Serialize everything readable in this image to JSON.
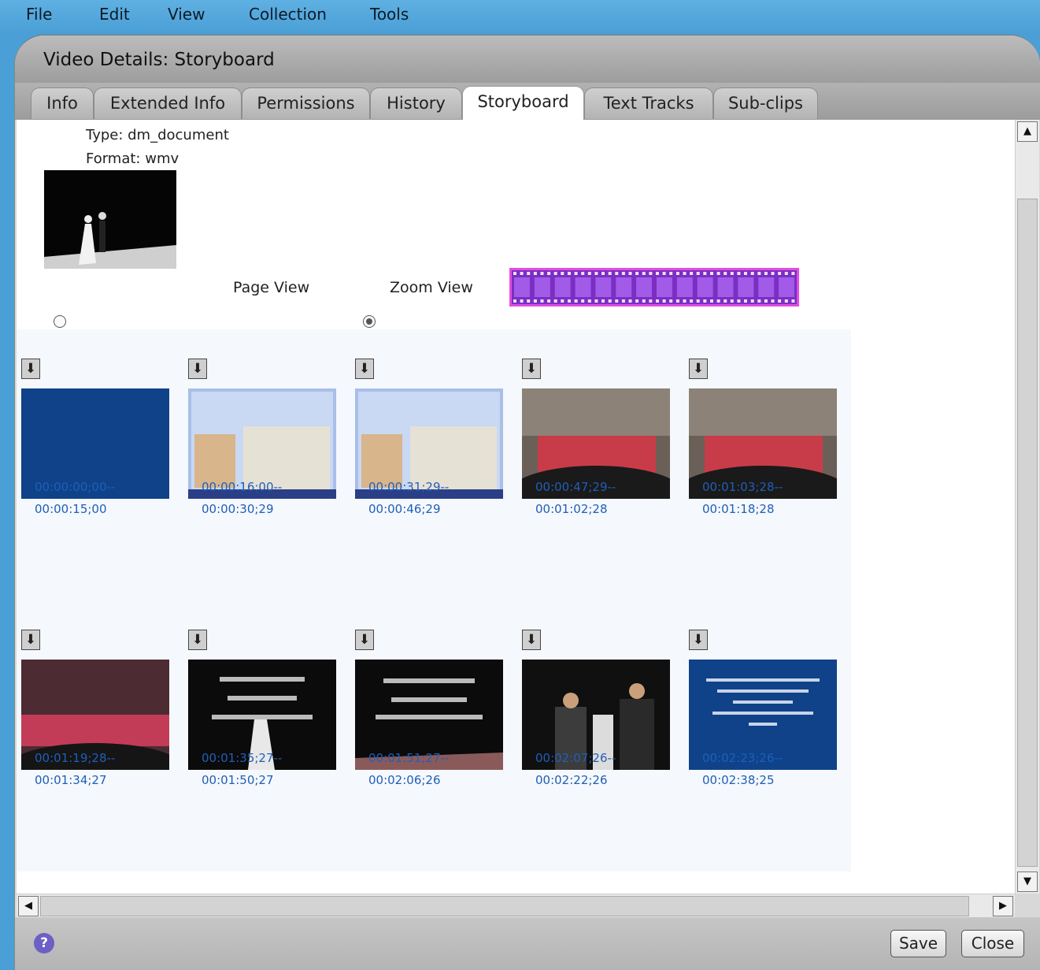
{
  "menu": [
    "File",
    "Edit",
    "View",
    "Collection",
    "Tools"
  ],
  "window": {
    "title": "Video Details: Storyboard"
  },
  "tabs": [
    {
      "label": "Info"
    },
    {
      "label": "Extended Info"
    },
    {
      "label": "Permissions"
    },
    {
      "label": "History"
    },
    {
      "label": "Storyboard",
      "active": true
    },
    {
      "label": "Text Tracks"
    },
    {
      "label": "Sub-clips"
    }
  ],
  "details": {
    "type": "Type: dm_document",
    "format": "Format: wmv"
  },
  "view_options": {
    "page_view": "Page View",
    "zoom_view": "Zoom View",
    "selected": "Zoom View"
  },
  "storyboard": [
    {
      "start": "00:00:00;00--",
      "end": "00:00:15;00"
    },
    {
      "start": "00:00:16;00--",
      "end": "00:00:30;29"
    },
    {
      "start": "00:00:31;29--",
      "end": "00:00:46;29"
    },
    {
      "start": "00:00:47;29--",
      "end": "00:01:02;28"
    },
    {
      "start": "00:01:03;28--",
      "end": "00:01:18;28"
    },
    {
      "start": "00:01:19;28--",
      "end": "00:01:34;27"
    },
    {
      "start": "00:01:35;27--",
      "end": "00:01:50;27"
    },
    {
      "start": "00:01:51;27--",
      "end": "00:02:06;26"
    },
    {
      "start": "00:02:07;26--",
      "end": "00:02:22;26"
    },
    {
      "start": "00:02:23;26--",
      "end": "00:02:38;25"
    }
  ],
  "footer": {
    "help": "?",
    "save": "Save",
    "close": "Close"
  },
  "icons": {
    "download": "download-icon",
    "scroll_up": "arrow-up-icon",
    "scroll_down": "arrow-down-icon",
    "scroll_left": "arrow-left-icon",
    "scroll_right": "arrow-right-icon"
  },
  "colors": {
    "desktop": "#4a9fd6",
    "timecode": "#1f5fb8",
    "filmstrip_border": "#e24ce0",
    "filmstrip_fill": "#7a2fc2"
  }
}
